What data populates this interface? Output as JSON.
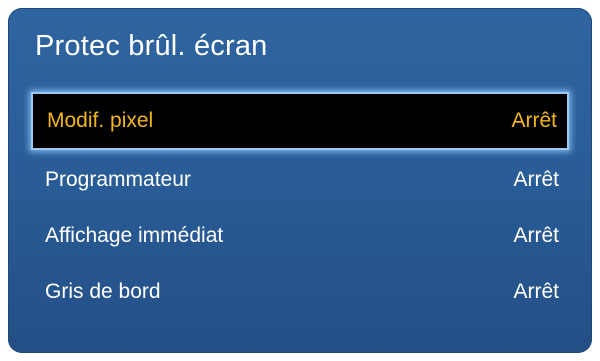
{
  "menu": {
    "title": "Protec brûl. écran",
    "items": [
      {
        "label": "Modif. pixel",
        "value": "Arrêt"
      },
      {
        "label": "Programmateur",
        "value": "Arrêt"
      },
      {
        "label": "Affichage immédiat",
        "value": "Arrêt"
      },
      {
        "label": "Gris de bord",
        "value": "Arrêt"
      }
    ]
  },
  "colors": {
    "panel_background": "#2a5d98",
    "selected_background": "#000000",
    "selected_text": "#f3b51c",
    "text": "#ffffff",
    "focus_border": "#9cc7f0"
  }
}
